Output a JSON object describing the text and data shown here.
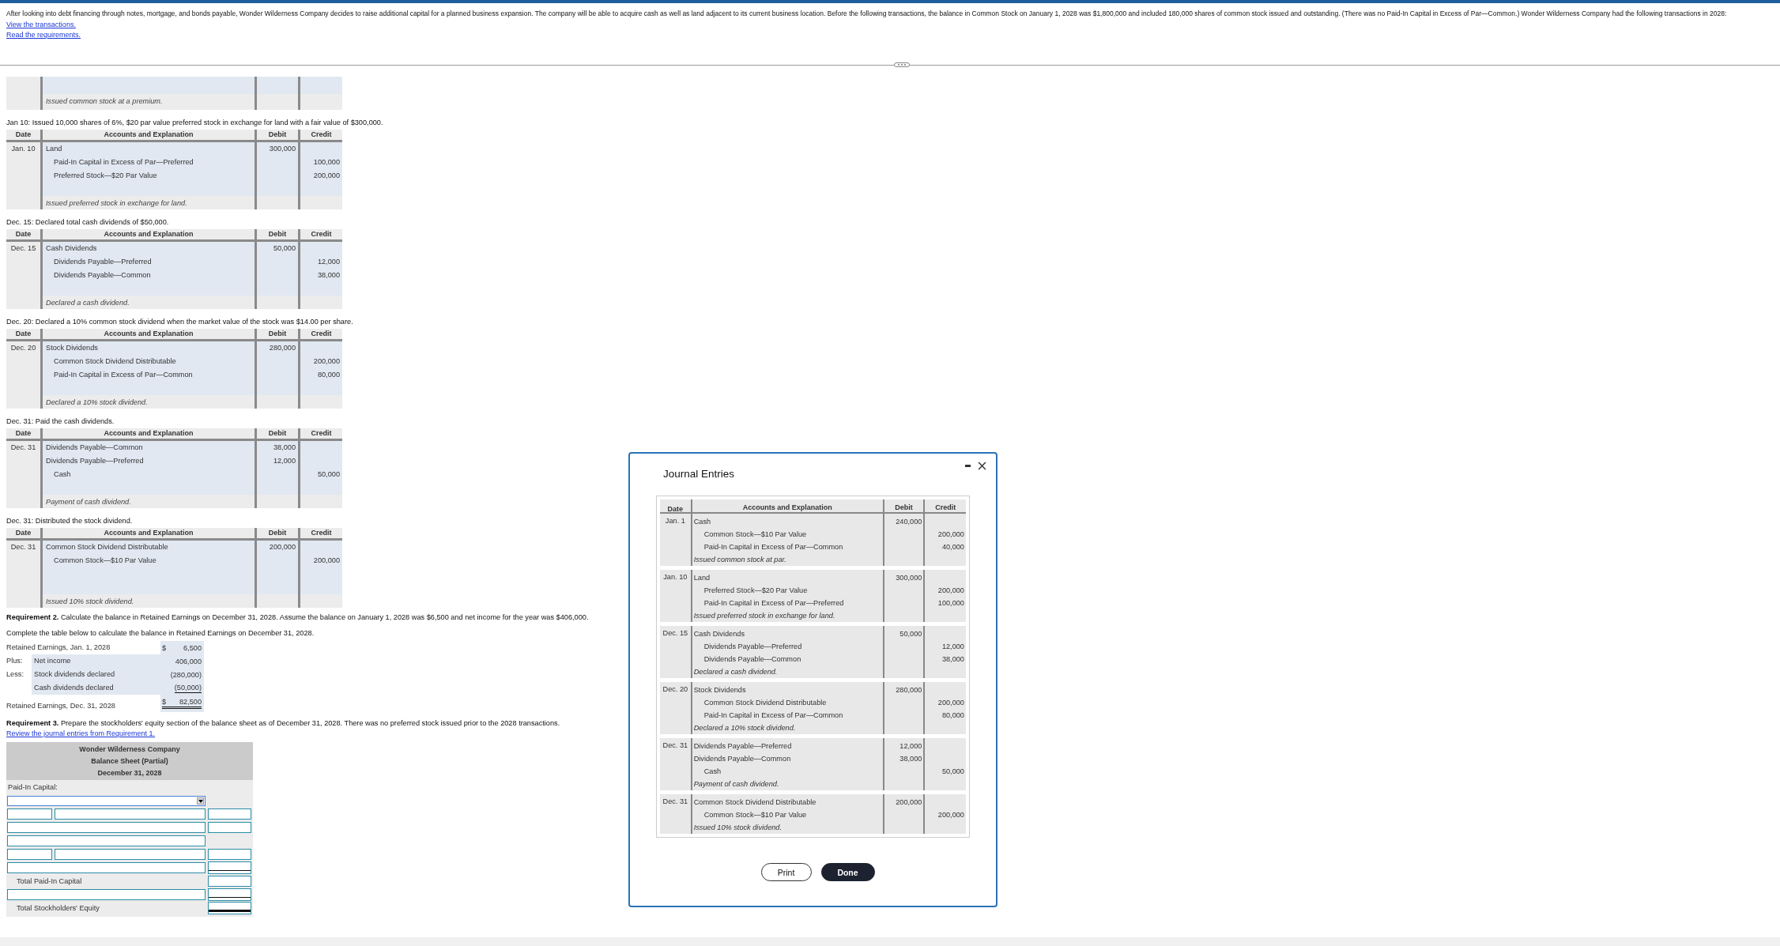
{
  "intro": {
    "text": "After looking into debt financing through notes, mortgage, and bonds payable, Wonder Wilderness Company decides to raise additional capital for a planned business expansion. The company will be able to acquire cash as well as land adjacent to its current business location. Before the following transactions, the balance in Common Stock on January 1, 2028 was $1,800,000 and included 180,000 shares of common stock issued and outstanding. (There was no Paid-In Capital in Excess of Par—Common.) Wonder Wilderness Company had the following transactions in 2028:",
    "links": [
      "View the transactions.",
      "Read the requirements."
    ]
  },
  "cut_entry": {
    "explanation": "Issued common stock at a premium."
  },
  "transactions": [
    {
      "caption": "Jan 10: Issued 10,000 shares of 6%, $20 par value preferred stock in exchange for land with a fair value of $300,000.",
      "columns": [
        "Date",
        "Accounts and Explanation",
        "Debit",
        "Credit"
      ],
      "date": "Jan. 10",
      "lines": [
        {
          "account": "Land",
          "indented": false,
          "debit": "300,000"
        },
        {
          "account": "Paid-In Capital in Excess of Par—Preferred",
          "indented": true,
          "credit": "100,000"
        },
        {
          "account": "Preferred Stock—$20 Par Value",
          "indented": true,
          "credit": "200,000"
        }
      ],
      "explanation": "Issued preferred stock in exchange for land."
    },
    {
      "caption": "Dec. 15: Declared total cash dividends of $50,000.",
      "columns": [
        "Date",
        "Accounts and Explanation",
        "Debit",
        "Credit"
      ],
      "date": "Dec. 15",
      "lines": [
        {
          "account": "Cash Dividends",
          "indented": false,
          "debit": "50,000"
        },
        {
          "account": "Dividends Payable—Preferred",
          "indented": true,
          "credit": "12,000"
        },
        {
          "account": "Dividends Payable—Common",
          "indented": true,
          "credit": "38,000"
        }
      ],
      "explanation": "Declared a cash dividend."
    },
    {
      "caption": "Dec. 20: Declared a 10% common stock dividend when the market value of the stock was $14.00 per share.",
      "columns": [
        "Date",
        "Accounts and Explanation",
        "Debit",
        "Credit"
      ],
      "date": "Dec. 20",
      "lines": [
        {
          "account": "Stock Dividends",
          "indented": false,
          "debit": "280,000"
        },
        {
          "account": "Common Stock Dividend Distributable",
          "indented": true,
          "credit": "200,000"
        },
        {
          "account": "Paid-In Capital in Excess of Par—Common",
          "indented": true,
          "credit": "80,000"
        }
      ],
      "explanation": "Declared a 10% stock dividend."
    },
    {
      "caption": "Dec. 31: Paid the cash dividends.",
      "columns": [
        "Date",
        "Accounts and Explanation",
        "Debit",
        "Credit"
      ],
      "date": "Dec. 31",
      "lines": [
        {
          "account": "Dividends Payable—Common",
          "indented": false,
          "debit": "38,000"
        },
        {
          "account": "Dividends Payable—Preferred",
          "indented": false,
          "debit": "12,000"
        },
        {
          "account": "Cash",
          "indented": true,
          "credit": "50,000"
        }
      ],
      "explanation": "Payment of cash dividend."
    },
    {
      "caption": "Dec. 31: Distributed the stock dividend.",
      "columns": [
        "Date",
        "Accounts and Explanation",
        "Debit",
        "Credit"
      ],
      "date": "Dec. 31",
      "lines": [
        {
          "account": "Common Stock Dividend Distributable",
          "indented": false,
          "debit": "200,000"
        },
        {
          "account": "Common Stock—$10 Par Value",
          "indented": true,
          "credit": "200,000"
        }
      ],
      "explanation": "Issued 10% stock dividend."
    }
  ],
  "requirement_2": {
    "heading": "Requirement 2.",
    "text": "Calculate the balance in Retained Earnings on December 31, 2028. Assume the balance on January 1, 2028 was $6,500 and net income for the year was $406,000.",
    "instruction": "Complete the table below to calculate the balance in Retained Earnings on December 31, 2028.",
    "rows": [
      {
        "kind": "total",
        "label": "Retained Earnings, Jan. 1, 2028",
        "currency": "$",
        "amount": "6,500",
        "underlined": false,
        "double_underlined": false
      },
      {
        "kind": "item",
        "prefix": "Plus:",
        "label": "Net income",
        "amount": "406,000",
        "underlined": false,
        "double_underlined": false
      },
      {
        "kind": "item",
        "prefix": "Less:",
        "label": "Stock dividends declared",
        "amount": "(280,000)",
        "underlined": false,
        "double_underlined": false
      },
      {
        "kind": "item",
        "label": "Cash dividends declared",
        "amount": "(50,000)",
        "underlined": true,
        "double_underlined": false
      },
      {
        "kind": "total",
        "label": "Retained Earnings, Dec. 31, 2028",
        "currency": "$",
        "amount": "82,500",
        "underlined": false,
        "double_underlined": true
      }
    ]
  },
  "requirement_3": {
    "heading": "Requirement 3.",
    "text": "Prepare the stockholders' equity section of the balance sheet as of December 31, 2028. There was no preferred stock issued prior to the 2028 transactions.",
    "link": "Review the journal entries from Requirement 1."
  },
  "balance_sheet": {
    "title": [
      "Wonder Wilderness Company",
      "Balance Sheet (Partial)",
      "December 31, 2028"
    ],
    "rows": [
      {
        "kind": "label",
        "label": "Paid-In Capital:"
      },
      {
        "kind": "select"
      },
      {
        "kind": "split",
        "amount": true,
        "underlined": false,
        "double_underlined": false
      },
      {
        "kind": "wide",
        "amount": true,
        "underlined": false,
        "double_underlined": false
      },
      {
        "kind": "wide",
        "amount": false
      },
      {
        "kind": "split",
        "amount": true,
        "underlined": false,
        "double_underlined": false
      },
      {
        "kind": "wide",
        "amount": true,
        "underlined": true,
        "double_underlined": false
      },
      {
        "kind": "total",
        "label": "Total Paid-In Capital",
        "underlined": false,
        "double_underlined": false
      },
      {
        "kind": "wide",
        "amount": true,
        "underlined": true,
        "double_underlined": false
      },
      {
        "kind": "total",
        "label": "Total Stockholders' Equity",
        "underlined": false,
        "double_underlined": true
      }
    ]
  },
  "dialog": {
    "title": "Journal Entries",
    "columns": [
      "Date",
      "Accounts and Explanation",
      "Debit",
      "Credit"
    ],
    "entries": [
      {
        "date": "Jan. 1",
        "lines": [
          {
            "account": "Cash",
            "indented": false,
            "debit": "240,000"
          },
          {
            "account": "Common Stock—$10 Par Value",
            "indented": true,
            "credit": "200,000"
          },
          {
            "account": "Paid-In Capital in Excess of Par—Common",
            "indented": true,
            "credit": "40,000"
          }
        ],
        "explanation": "Issued common stock at par."
      },
      {
        "date": "Jan. 10",
        "lines": [
          {
            "account": "Land",
            "indented": false,
            "debit": "300,000"
          },
          {
            "account": "Preferred Stock—$20 Par Value",
            "indented": true,
            "credit": "200,000"
          },
          {
            "account": "Paid-In Capital in Excess of Par—Preferred",
            "indented": true,
            "credit": "100,000"
          }
        ],
        "explanation": "Issued preferred stock in exchange for land."
      },
      {
        "date": "Dec. 15",
        "lines": [
          {
            "account": "Cash Dividends",
            "indented": false,
            "debit": "50,000"
          },
          {
            "account": "Dividends Payable—Preferred",
            "indented": true,
            "credit": "12,000"
          },
          {
            "account": "Dividends Payable—Common",
            "indented": true,
            "credit": "38,000"
          }
        ],
        "explanation": "Declared a cash dividend."
      },
      {
        "date": "Dec. 20",
        "lines": [
          {
            "account": "Stock Dividends",
            "indented": false,
            "debit": "280,000"
          },
          {
            "account": "Common Stock Dividend Distributable",
            "indented": true,
            "credit": "200,000"
          },
          {
            "account": "Paid-In Capital in Excess of Par—Common",
            "indented": true,
            "credit": "80,000"
          }
        ],
        "explanation": "Declared a 10% stock dividend."
      },
      {
        "date": "Dec. 31",
        "lines": [
          {
            "account": "Dividends Payable—Preferred",
            "indented": false,
            "debit": "12,000"
          },
          {
            "account": "Dividends Payable—Common",
            "indented": false,
            "debit": "38,000"
          },
          {
            "account": "Cash",
            "indented": true,
            "credit": "50,000"
          }
        ],
        "explanation": "Payment of cash dividend."
      },
      {
        "date": "Dec. 31",
        "lines": [
          {
            "account": "Common Stock Dividend Distributable",
            "indented": false,
            "debit": "200,000"
          },
          {
            "account": "Common Stock—$10 Par Value",
            "indented": true,
            "credit": "200,000"
          }
        ],
        "explanation": "Issued 10% stock dividend."
      }
    ],
    "buttons": [
      "Print",
      "Done"
    ]
  }
}
